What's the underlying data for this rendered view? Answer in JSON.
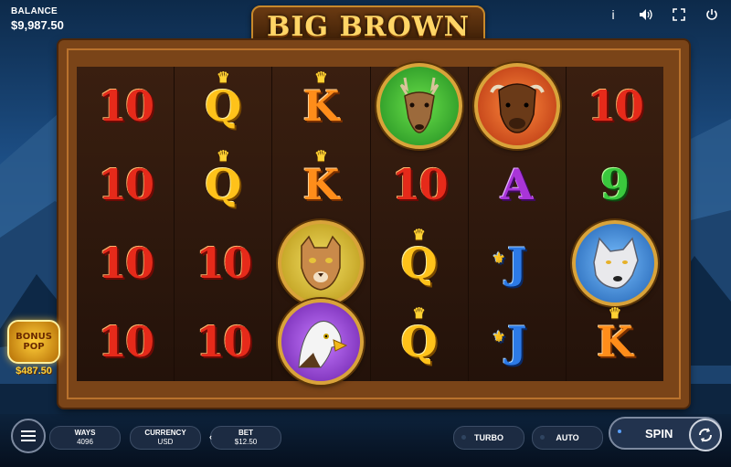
{
  "balance": {
    "label": "BALANCE",
    "value": "$9,987.50"
  },
  "logo": {
    "text": "BIG BROWN"
  },
  "top_icons": [
    "info-icon",
    "sound-icon",
    "fullscreen-icon",
    "power-icon"
  ],
  "reels": [
    [
      "10",
      "10",
      "10",
      "10"
    ],
    [
      "Q",
      "Q",
      "10",
      "10"
    ],
    [
      "K",
      "K",
      "cougar",
      "eagle"
    ],
    [
      "deer",
      "10",
      "Q",
      "Q"
    ],
    [
      "bison",
      "A",
      "J",
      "J"
    ],
    [
      "10",
      "9",
      "wolf",
      "K"
    ]
  ],
  "bonus_pop": {
    "line1": "BONUS",
    "line2": "POP",
    "value": "$487.50"
  },
  "controls": {
    "ways_label": "WAYS",
    "ways_value": "4096",
    "currency_label": "CURRENCY",
    "currency_value": "USD",
    "bet_label": "BET",
    "bet_value": "$12.50",
    "turbo_label": "TURBO",
    "auto_label": "AUTO",
    "spin_label": "SPIN"
  }
}
